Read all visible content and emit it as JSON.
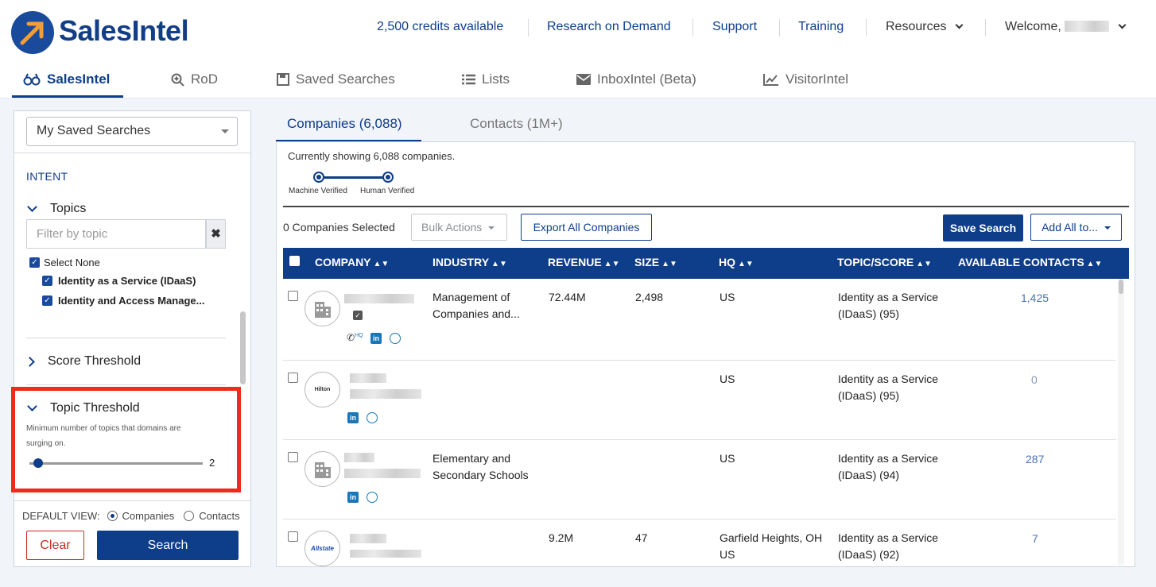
{
  "app": {
    "logo_text": "SalesIntel"
  },
  "topnav": {
    "credits": "2,500 credits available",
    "research": "Research on Demand",
    "support": "Support",
    "training": "Training",
    "resources": "Resources",
    "welcome": "Welcome,"
  },
  "main_tabs": [
    {
      "label": "SalesIntel",
      "icon": "binoculars-icon",
      "active": true
    },
    {
      "label": "RoD",
      "icon": "magnifier-plus-icon"
    },
    {
      "label": "Saved Searches",
      "icon": "save-icon"
    },
    {
      "label": "Lists",
      "icon": "list-icon"
    },
    {
      "label": "InboxIntel (Beta)",
      "icon": "envelope-icon"
    },
    {
      "label": "VisitorIntel",
      "icon": "line-chart-icon"
    }
  ],
  "sidebar": {
    "saved_searches_select": "My Saved Searches",
    "intent_label": "INTENT",
    "topics_title": "Topics",
    "filter_placeholder": "Filter by topic",
    "select_none": "Select None",
    "topic_items": [
      "Identity as a Service (IDaaS)",
      "Identity and Access Manage..."
    ],
    "score_threshold_title": "Score Threshold",
    "topic_threshold_title": "Topic Threshold",
    "topic_threshold_desc": "Minimum number of topics that domains are surging on.",
    "topic_threshold_value": "2",
    "default_view_label": "DEFAULT VIEW:",
    "view_companies": "Companies",
    "view_contacts": "Contacts",
    "default_view_selected": "Companies",
    "clear_button": "Clear",
    "search_button": "Search",
    "highlight_color": "#ef2b1e"
  },
  "results": {
    "tab_companies": "Companies (6,088)",
    "tab_contacts": "Contacts (1M+)",
    "showing_text": "Currently showing 6,088 companies.",
    "verify_machine": "Machine Verified",
    "verify_human": "Human Verified",
    "selected_count": "0 Companies Selected",
    "bulk_actions": "Bulk Actions",
    "export_all": "Export All Companies",
    "save_search": "Save Search",
    "add_all": "Add All to...",
    "columns": [
      "COMPANY",
      "INDUSTRY",
      "REVENUE",
      "SIZE",
      "HQ",
      "TOPIC/SCORE",
      "AVAILABLE CONTACTS"
    ],
    "rows": [
      {
        "industry": "Management of Companies and...",
        "revenue": "72.44M",
        "size": "2,498",
        "hq": "US",
        "topic": "Identity as a Service (IDaaS) (95)",
        "contacts": "1,425",
        "logo": "building-icon"
      },
      {
        "industry": "",
        "revenue": "",
        "size": "",
        "hq": "US",
        "topic": "Identity as a Service (IDaaS) (95)",
        "contacts": "0",
        "logo": "Hilton"
      },
      {
        "industry": "Elementary and Secondary Schools",
        "revenue": "",
        "size": "",
        "hq": "US",
        "topic": "Identity as a Service (IDaaS) (94)",
        "contacts": "287",
        "logo": "building-icon"
      },
      {
        "industry": "",
        "revenue": "9.2M",
        "size": "47",
        "hq": "Garfield Heights, OH US",
        "topic": "Identity as a Service (IDaaS) (92)",
        "contacts": "7",
        "logo": "Allstate"
      }
    ],
    "hq_badge": "HQ"
  },
  "colors": {
    "brand": "#0e3d8a",
    "link": "#4a72b8",
    "danger": "#c62d22"
  }
}
